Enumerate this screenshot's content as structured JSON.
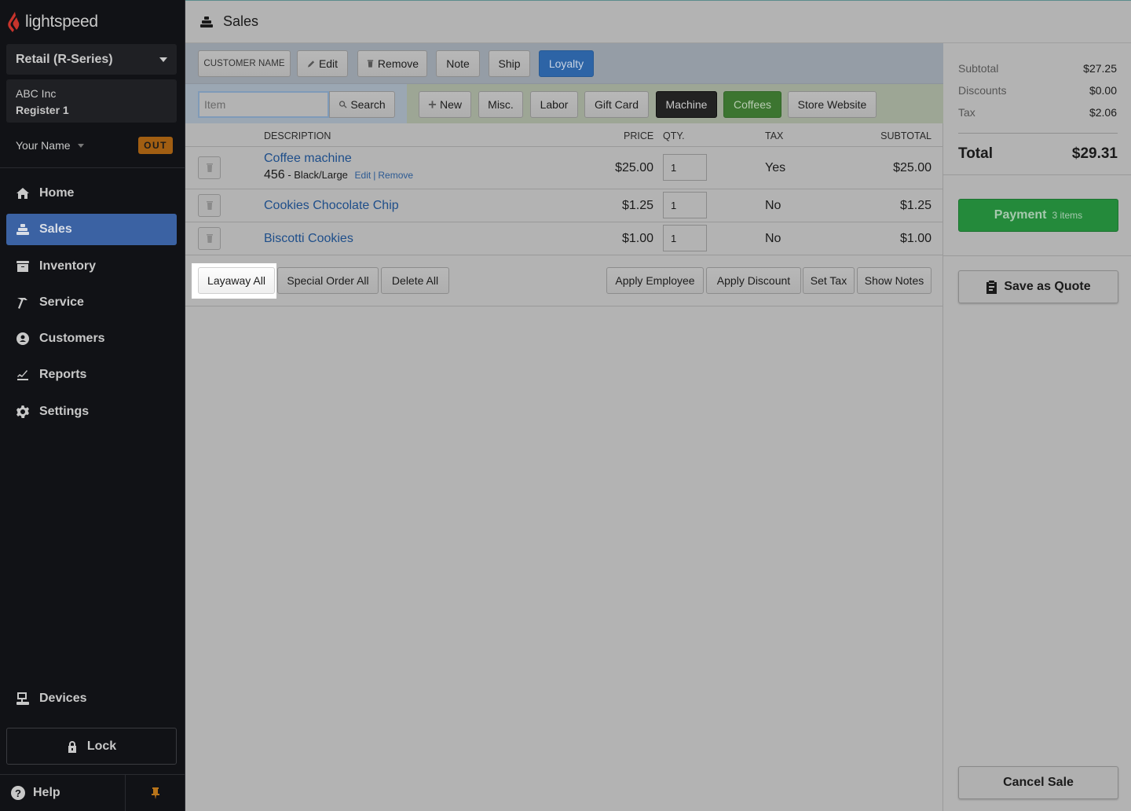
{
  "app": {
    "brand": "lightspeed",
    "brand_color": "#c8342c"
  },
  "sidebar": {
    "product_select": "Retail (R-Series)",
    "company": "ABC Inc",
    "register": "Register 1",
    "user_name": "Your Name",
    "clock_badge": "OUT",
    "items": [
      {
        "label": "Home",
        "icon": "home-icon",
        "active": false
      },
      {
        "label": "Sales",
        "icon": "cash-register-icon",
        "active": true
      },
      {
        "label": "Inventory",
        "icon": "archive-box-icon",
        "active": false
      },
      {
        "label": "Service",
        "icon": "hammer-icon",
        "active": false
      },
      {
        "label": "Customers",
        "icon": "user-circle-icon",
        "active": false
      },
      {
        "label": "Reports",
        "icon": "chart-line-icon",
        "active": false
      },
      {
        "label": "Settings",
        "icon": "gear-icon",
        "active": false
      }
    ],
    "devices_label": "Devices",
    "lock_label": "Lock",
    "help_label": "Help",
    "help_icon_glyph": "?"
  },
  "header": {
    "title": "Sales"
  },
  "customer_bar": {
    "customer_name": "CUSTOMER NAME",
    "edit": "Edit",
    "remove": "Remove",
    "note": "Note",
    "ship": "Ship",
    "loyalty": "Loyalty"
  },
  "search": {
    "placeholder": "Item",
    "button": "Search"
  },
  "quick_buttons": {
    "new": "New",
    "misc": "Misc.",
    "labor": "Labor",
    "gift_card": "Gift Card",
    "machine": "Machine",
    "coffees": "Coffees",
    "store_website": "Store Website"
  },
  "table": {
    "headers": {
      "description": "DESCRIPTION",
      "price": "PRICE",
      "qty": "QTY.",
      "tax": "TAX",
      "subtotal": "SUBTOTAL"
    },
    "rows": [
      {
        "description": "Coffee machine",
        "sku": "456",
        "separator": " - ",
        "variant": "Black/Large",
        "edit": "Edit",
        "pipe": "|",
        "remove": "Remove",
        "price": "$25.00",
        "qty": "1",
        "tax": "Yes",
        "subtotal": "$25.00"
      },
      {
        "description": "Cookies Chocolate Chip",
        "price": "$1.25",
        "qty": "1",
        "tax": "No",
        "subtotal": "$1.25"
      },
      {
        "description": "Biscotti Cookies",
        "price": "$1.00",
        "qty": "1",
        "tax": "No",
        "subtotal": "$1.00"
      }
    ]
  },
  "actions": {
    "layaway_all": "Layaway All",
    "special_order_all": "Special Order All",
    "delete_all": "Delete All",
    "apply_employee": "Apply Employee",
    "apply_discount": "Apply Discount",
    "set_tax": "Set Tax",
    "show_notes": "Show Notes"
  },
  "summary": {
    "subtotal_label": "Subtotal",
    "subtotal": "$27.25",
    "discounts_label": "Discounts",
    "discounts": "$0.00",
    "tax_label": "Tax",
    "tax": "$2.06",
    "total_label": "Total",
    "total": "$29.31"
  },
  "payment": {
    "label": "Payment",
    "count": "3 items"
  },
  "save_quote": "Save as Quote",
  "cancel_sale": "Cancel Sale"
}
